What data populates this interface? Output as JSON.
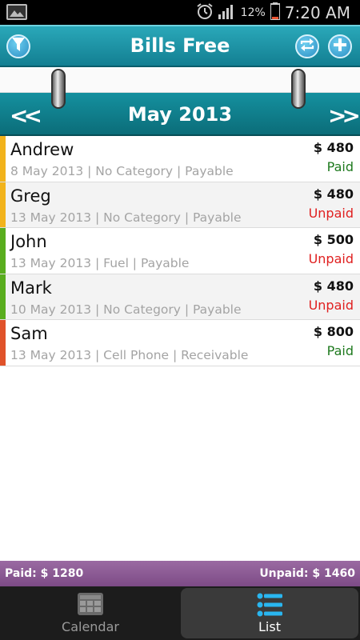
{
  "status_bar": {
    "battery_pct": "12%",
    "time": "7:20 AM"
  },
  "header": {
    "title": "Bills Free",
    "icons": [
      "filter-icon",
      "sync-icon",
      "add-icon"
    ]
  },
  "month": {
    "label": "May 2013",
    "prev_glyph": "<<",
    "next_glyph": ">>"
  },
  "bills": [
    {
      "name": "Andrew",
      "meta": "8 May 2013 | No Category | Payable",
      "amount": "$ 480",
      "status": "Paid",
      "color": "#f2b31b"
    },
    {
      "name": "Greg",
      "meta": "13 May 2013 | No Category | Payable",
      "amount": "$ 480",
      "status": "Unpaid",
      "color": "#f2b31b"
    },
    {
      "name": "John",
      "meta": "13 May 2013 | Fuel | Payable",
      "amount": "$ 500",
      "status": "Unpaid",
      "color": "#59ad1e"
    },
    {
      "name": "Mark",
      "meta": "10 May 2013 | No Category | Payable",
      "amount": "$ 480",
      "status": "Unpaid",
      "color": "#59ad1e"
    },
    {
      "name": "Sam",
      "meta": "13 May 2013 | Cell Phone | Receivable",
      "amount": "$ 800",
      "status": "Paid",
      "color": "#e0522a"
    }
  ],
  "summary": {
    "paid": "Paid: $ 1280",
    "unpaid": "Unpaid: $ 1460"
  },
  "tabs": {
    "calendar": "Calendar",
    "list": "List",
    "active": "list"
  },
  "colors": {
    "header": "#1f94a7",
    "paid": "#1f7a1f",
    "unpaid": "#e02020",
    "summary": "#8a5a93"
  }
}
